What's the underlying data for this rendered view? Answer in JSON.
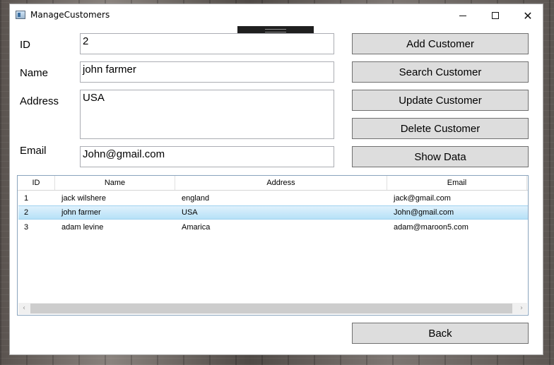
{
  "window": {
    "title": "ManageCustomers",
    "controls": {
      "minimize": "—",
      "maximize": "☐",
      "close": "✕"
    }
  },
  "form": {
    "id_label": "ID",
    "id_value": "2",
    "name_label": "Name",
    "name_value": "john farmer",
    "address_label": "Address",
    "address_value": "USA",
    "email_label": "Email",
    "email_value": "John@gmail.com"
  },
  "buttons": {
    "add": "Add Customer",
    "search": "Search Customer",
    "update": "Update Customer",
    "delete": "Delete Customer",
    "show": "Show Data",
    "back": "Back"
  },
  "grid": {
    "columns": [
      "ID",
      "Name",
      "Address",
      "Email"
    ],
    "rows": [
      {
        "id": "1",
        "name": "jack wilshere",
        "address": "england",
        "email": "jack@gmail.com",
        "selected": false
      },
      {
        "id": "2",
        "name": "john farmer",
        "address": "USA",
        "email": "John@gmail.com",
        "selected": true
      },
      {
        "id": "3",
        "name": "adam levine",
        "address": "Amarica",
        "email": "adam@maroon5.com",
        "selected": false
      }
    ]
  },
  "scrollbar": {
    "left_arrow": "‹",
    "right_arrow": "›"
  },
  "colors": {
    "selection_top": "#dff1fc",
    "selection_bottom": "#b6e1f7",
    "button_bg": "#dddddd",
    "grid_border": "#8aa4bd"
  }
}
